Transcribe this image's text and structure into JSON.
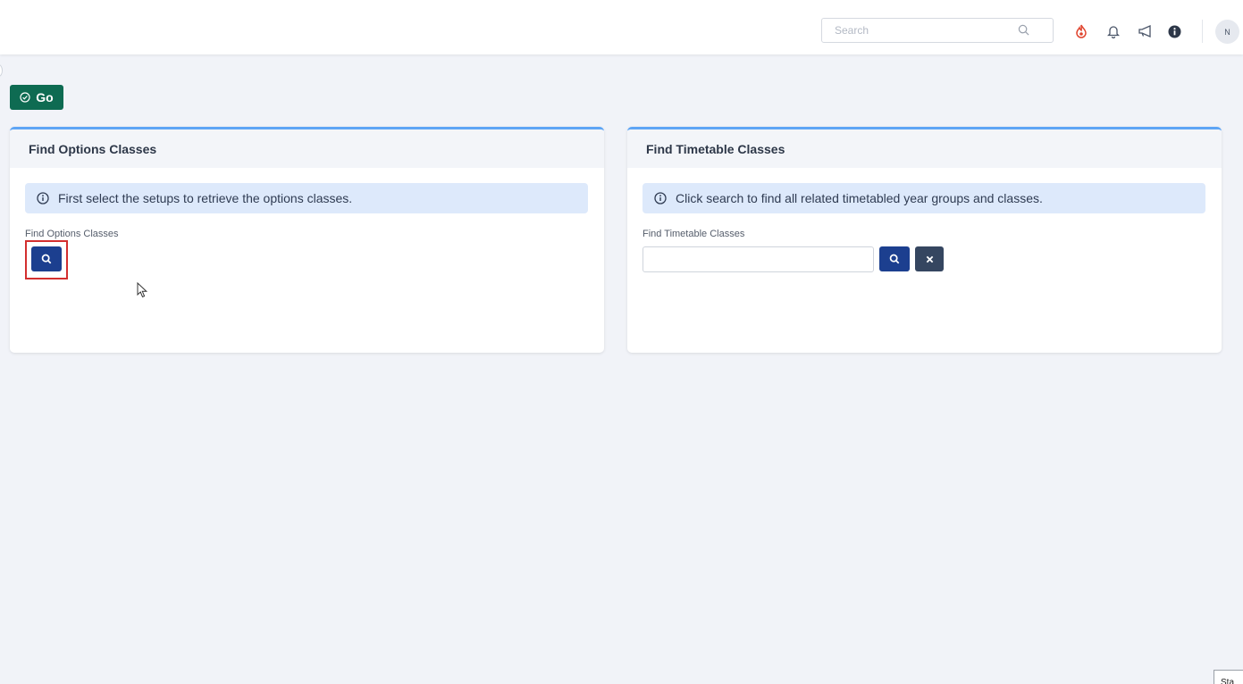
{
  "header": {
    "search": {
      "placeholder": "Search",
      "value": ""
    },
    "icons": [
      "search-icon",
      "flame-icon",
      "bell-icon",
      "megaphone-icon",
      "info-icon"
    ],
    "avatar_initial": "N"
  },
  "toolbar": {
    "go_label": "Go",
    "go_color": "#0e6b52"
  },
  "panels": {
    "options": {
      "title": "Find Options Classes",
      "info": "First select the setups to retrieve the options classes.",
      "field_label": "Find Options Classes"
    },
    "timetable": {
      "title": "Find Timetable Classes",
      "info": "Click search to find all related timetabled year groups and classes.",
      "field_label": "Find Timetable Classes",
      "input_value": ""
    }
  },
  "colors": {
    "accent_blue": "#1c3f8f",
    "panel_top_border": "#5ea5f5",
    "info_bg": "#dde9fb",
    "highlight": "#d32f2f"
  },
  "corner_tag": "Sta"
}
